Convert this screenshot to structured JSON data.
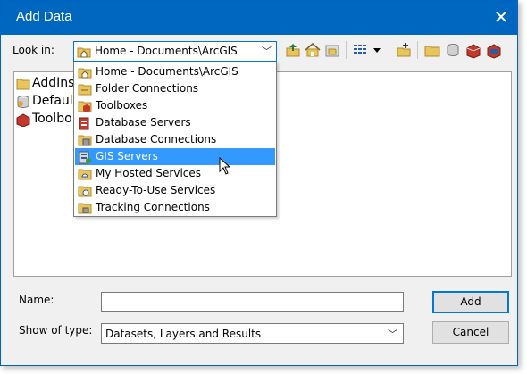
{
  "window": {
    "title": "Add Data",
    "close_glyph": "✕"
  },
  "lookin": {
    "label": "Look in:",
    "value": "Home - Documents\\ArcGIS",
    "icon": "home-folder-icon"
  },
  "toolbar": [
    {
      "name": "up-one-level-icon"
    },
    {
      "name": "home-icon"
    },
    {
      "name": "connect-folder-icon"
    },
    {
      "name": "view-options-icon"
    },
    {
      "name": "view-dropdown-icon"
    },
    {
      "name": "new-item-icon"
    },
    {
      "name": "folder-icon"
    },
    {
      "name": "database-icon"
    },
    {
      "name": "toolbox-icon"
    },
    {
      "name": "delete-icon"
    }
  ],
  "filelist": [
    {
      "label": "AddIns",
      "icon": "folder-icon"
    },
    {
      "label": "Default",
      "icon": "geodatabase-icon"
    },
    {
      "label": "Toolbo",
      "icon": "toolbox-icon"
    }
  ],
  "dropdown": {
    "items": [
      {
        "label": "Home - Documents\\ArcGIS",
        "icon": "home-folder-icon"
      },
      {
        "label": "Folder Connections",
        "icon": "folder-connections-icon"
      },
      {
        "label": "Toolboxes",
        "icon": "toolboxes-icon"
      },
      {
        "label": "Database Servers",
        "icon": "database-servers-icon"
      },
      {
        "label": "Database Connections",
        "icon": "database-connections-icon"
      },
      {
        "label": "GIS Servers",
        "icon": "gis-servers-icon",
        "selected": true
      },
      {
        "label": "My Hosted Services",
        "icon": "hosted-services-icon"
      },
      {
        "label": "Ready-To-Use Services",
        "icon": "ready-to-use-icon"
      },
      {
        "label": "Tracking Connections",
        "icon": "tracking-connections-icon"
      }
    ]
  },
  "name_field": {
    "label": "Name:",
    "value": ""
  },
  "type_field": {
    "label": "Show of type:",
    "value": "Datasets, Layers and Results"
  },
  "buttons": {
    "add": "Add",
    "cancel": "Cancel"
  },
  "colors": {
    "titlebar": "#0067c0",
    "selection": "#3399ff",
    "accent_border": "#0078d7"
  }
}
